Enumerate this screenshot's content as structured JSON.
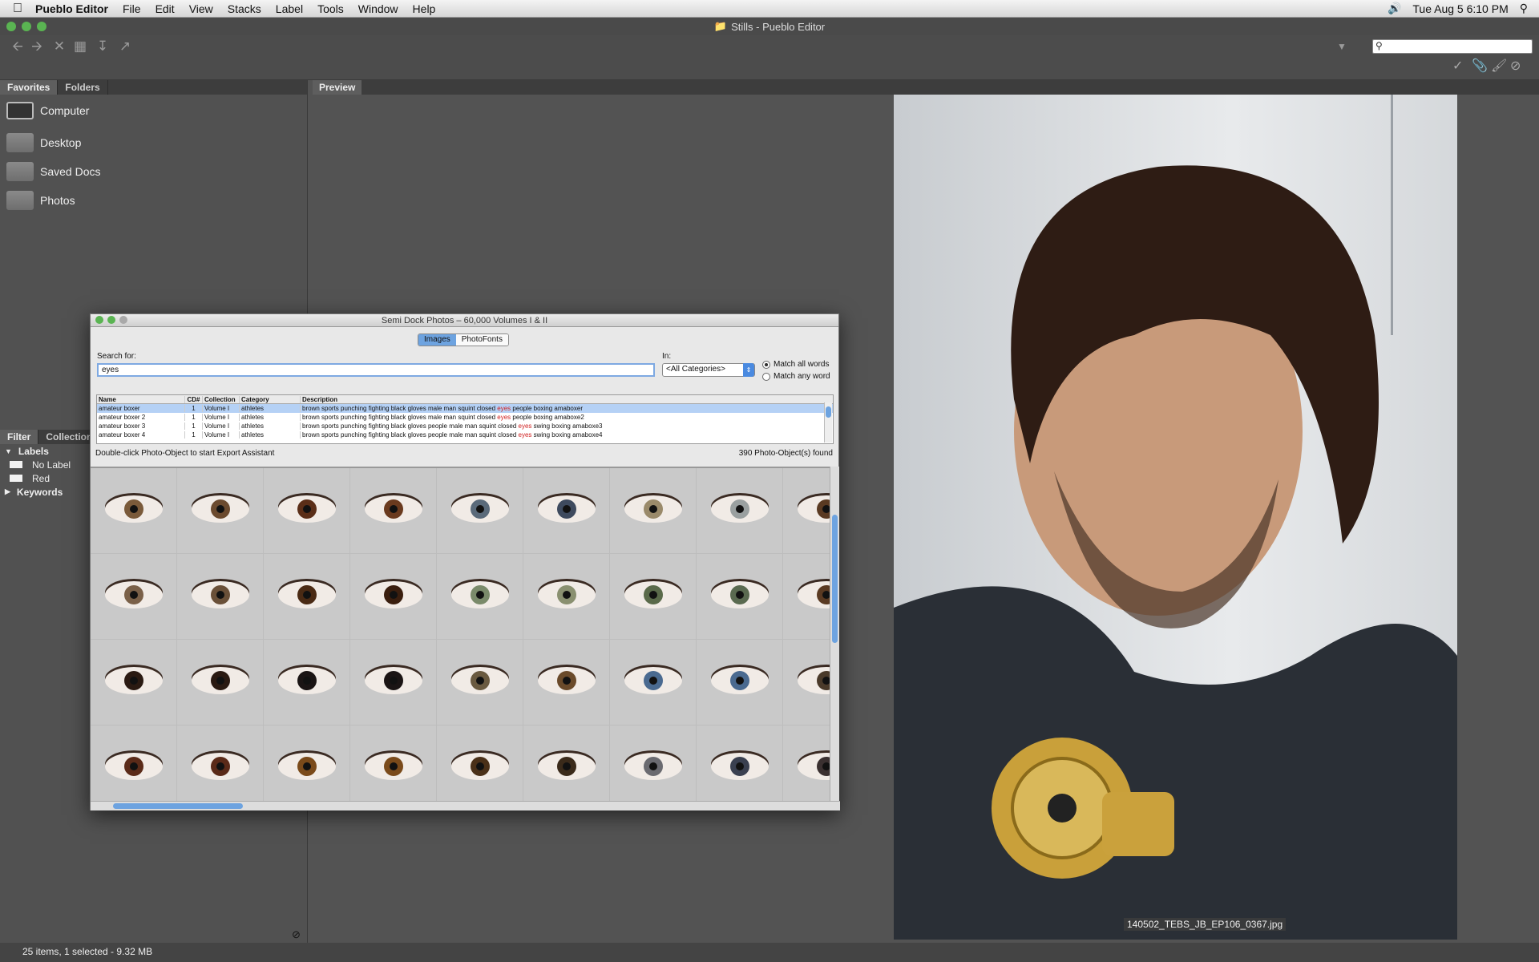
{
  "menubar": {
    "app_name": "Pueblo Editor",
    "items": [
      "File",
      "Edit",
      "View",
      "Stacks",
      "Label",
      "Tools",
      "Window",
      "Help"
    ],
    "clock": "Tue Aug 5  6:10 PM"
  },
  "window": {
    "title": "Stills - Pueblo Editor"
  },
  "left_panel": {
    "tabs": [
      "Favorites",
      "Folders"
    ],
    "favorites": [
      "Computer",
      "Desktop",
      "Saved Docs",
      "Photos"
    ],
    "filter_tabs": [
      "Filter",
      "Collection"
    ],
    "labels_header": "Labels",
    "labels": [
      {
        "name": "No Label"
      },
      {
        "name": "Red"
      }
    ],
    "keywords_header": "Keywords"
  },
  "preview": {
    "tab": "Preview",
    "caption": "140502_TEBS_JB_EP106_0367.jpg"
  },
  "status": "25 items, 1 selected - 9.32 MB",
  "semi_dock": {
    "title": "Semi Dock Photos – 60,000 Volumes I & II",
    "tabs": [
      "Images",
      "PhotoFonts"
    ],
    "search_label": "Search for:",
    "search_value": "eyes",
    "in_label": "In:",
    "category": "<All Categories>",
    "match_all": "Match all words",
    "match_any": "Match any word",
    "columns": [
      "Name",
      "CD#",
      "Collection",
      "Category",
      "Description"
    ],
    "rows": [
      {
        "name": "amateur boxer",
        "cd": "1",
        "collection": "Volume I",
        "category": "athletes",
        "desc_before": "brown sports punching fighting black gloves male man squint closed ",
        "desc_hl": "eyes",
        "desc_after": " people boxing amaboxer"
      },
      {
        "name": "amateur boxer 2",
        "cd": "1",
        "collection": "Volume I",
        "category": "athletes",
        "desc_before": "brown sports punching fighting black gloves male man squint closed ",
        "desc_hl": "eyes",
        "desc_after": " people boxing amaboxe2"
      },
      {
        "name": "amateur boxer 3",
        "cd": "1",
        "collection": "Volume I",
        "category": "athletes",
        "desc_before": "brown sports punching fighting black gloves people male man squint closed ",
        "desc_hl": "eyes",
        "desc_after": " swing boxing amaboxe3"
      },
      {
        "name": "amateur boxer 4",
        "cd": "1",
        "collection": "Volume I",
        "category": "athletes",
        "desc_before": "brown sports punching fighting black gloves people male man squint closed ",
        "desc_hl": "eyes",
        "desc_after": " swing boxing amaboxe4"
      }
    ],
    "hint": "Double-click Photo-Object to start Export Assistant",
    "count": "390 Photo-Object(s) found",
    "iris_colors": [
      "#7a5a3a",
      "#6b4a2e",
      "#5a2e18",
      "#6a3a1e",
      "#5a6a7a",
      "#3e4a5e",
      "#9a8a6a",
      "#9aa0a0",
      "#5a3a22",
      "#7a6048",
      "#6a5038",
      "#4a2a14",
      "#3a1e0e",
      "#7a8a6a",
      "#8a9070",
      "#5a6a4a",
      "#5a6a50",
      "#5a3a22",
      "#2a1a12",
      "#2a1a12",
      "#1a1414",
      "#1a1414",
      "#6a5a40",
      "#6a4a2a",
      "#4a6a90",
      "#4a6a90",
      "#4a3a2a",
      "#5a2a18",
      "#5a2a18",
      "#7a4a1a",
      "#7a4a1a",
      "#4a3018",
      "#3a2a1a",
      "#6a6a70",
      "#3a4050",
      "#3a3030"
    ]
  }
}
